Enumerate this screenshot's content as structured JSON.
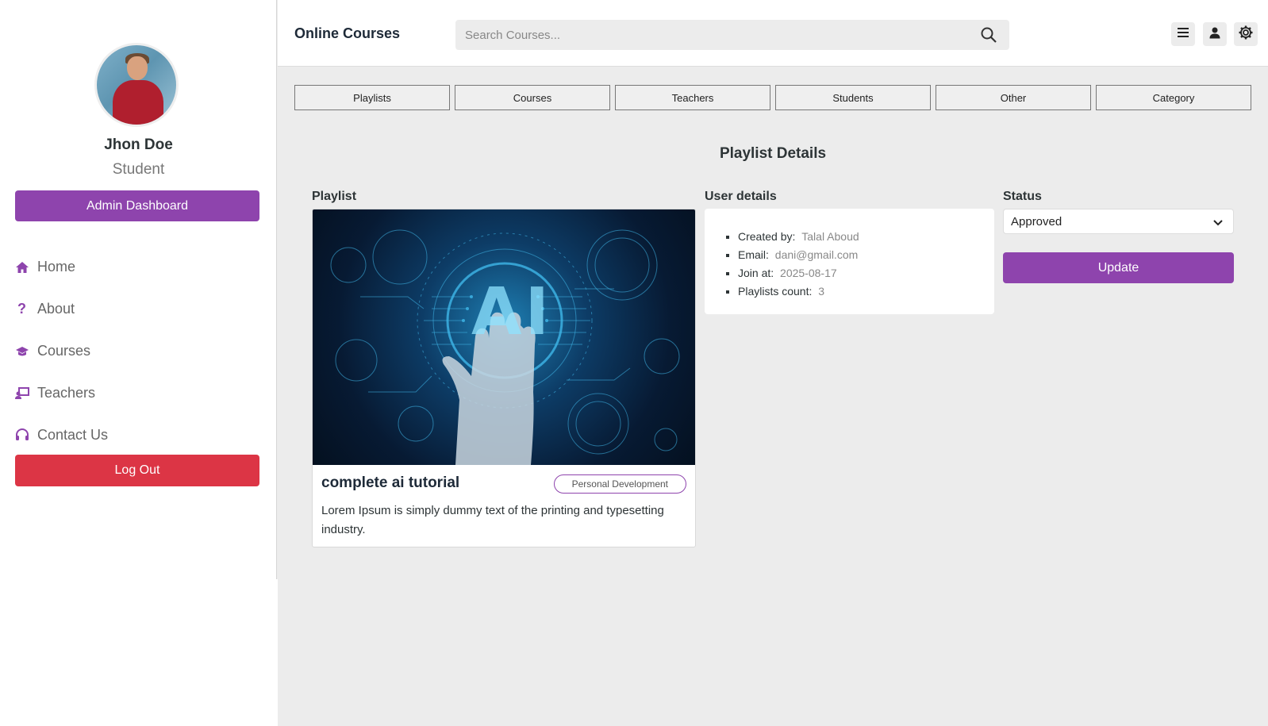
{
  "app": {
    "brand": "Online Courses"
  },
  "search": {
    "placeholder": "Search Courses..."
  },
  "profile": {
    "name": "Jhon Doe",
    "role": "Student"
  },
  "sidebar": {
    "admin_button": "Admin Dashboard",
    "items": [
      {
        "label": "Home",
        "icon": "home-icon"
      },
      {
        "label": "About",
        "icon": "question-icon"
      },
      {
        "label": "Courses",
        "icon": "graduation-cap-icon"
      },
      {
        "label": "Teachers",
        "icon": "chalkboard-teacher-icon"
      },
      {
        "label": "Contact Us",
        "icon": "headset-icon"
      }
    ],
    "logout_button": "Log Out"
  },
  "header_icons": [
    "menu-icon",
    "user-icon",
    "gear-icon"
  ],
  "tabs": [
    "Playlists",
    "Courses",
    "Teachers",
    "Students",
    "Other",
    "Category"
  ],
  "page_title": "Playlist Details",
  "playlist": {
    "label": "Playlist",
    "title": "complete ai tutorial",
    "category": "Personal Development",
    "description": "Lorem Ipsum is simply dummy text of the printing and typesetting industry.",
    "image_text": "AI"
  },
  "user_details": {
    "label": "User details",
    "created_by_label": "Created by:",
    "created_by": "Talal Aboud",
    "email_label": "Email:",
    "email": "dani@gmail.com",
    "join_label": "Join at:",
    "join": "2025-08-17",
    "count_label": "Playlists count:",
    "count": "3"
  },
  "status": {
    "label": "Status",
    "value": "Approved",
    "update_button": "Update"
  },
  "colors": {
    "accent": "#8e44ad",
    "danger": "#dc3545",
    "background": "#ececec"
  }
}
